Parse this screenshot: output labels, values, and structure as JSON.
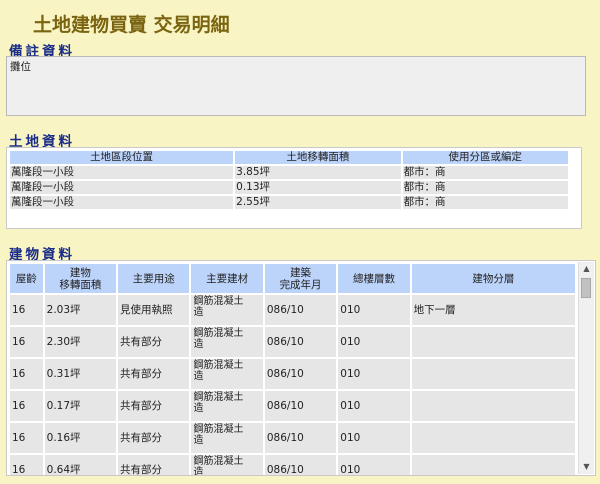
{
  "page": {
    "title": "土地建物買賣 交易明細"
  },
  "remarks": {
    "heading": "備註資料",
    "text": "攤位"
  },
  "land": {
    "heading": "土地資料",
    "columns": [
      "土地區段位置",
      "土地移轉面積",
      "使用分區或編定"
    ],
    "rows": [
      [
        "萬隆段一小段",
        "3.85坪",
        "都市：商"
      ],
      [
        "萬隆段一小段",
        "0.13坪",
        "都市：商"
      ],
      [
        "萬隆段一小段",
        "2.55坪",
        "都市：商"
      ]
    ]
  },
  "building": {
    "heading": "建物資料",
    "columns": [
      "屋齡",
      "建物\n移轉面積",
      "主要用途",
      "主要建材",
      "建築\n完成年月",
      "總樓層數",
      "建物分層"
    ],
    "rows": [
      [
        "16",
        "2.03坪",
        "見使用執照",
        "鋼筋混凝土\n造",
        "086/10",
        "010",
        "地下一層"
      ],
      [
        "16",
        "2.30坪",
        "共有部分",
        "鋼筋混凝土\n造",
        "086/10",
        "010",
        ""
      ],
      [
        "16",
        "0.31坪",
        "共有部分",
        "鋼筋混凝土\n造",
        "086/10",
        "010",
        ""
      ],
      [
        "16",
        "0.17坪",
        "共有部分",
        "鋼筋混凝土\n造",
        "086/10",
        "010",
        ""
      ],
      [
        "16",
        "0.16坪",
        "共有部分",
        "鋼筋混凝土\n造",
        "086/10",
        "010",
        ""
      ],
      [
        "16",
        "0.64坪",
        "共有部分",
        "鋼筋混凝土\n造",
        "086/10",
        "010",
        ""
      ]
    ]
  },
  "icons": {
    "scroll_up": "scroll-up-arrow-icon",
    "scroll_down": "scroll-down-arrow-icon"
  }
}
